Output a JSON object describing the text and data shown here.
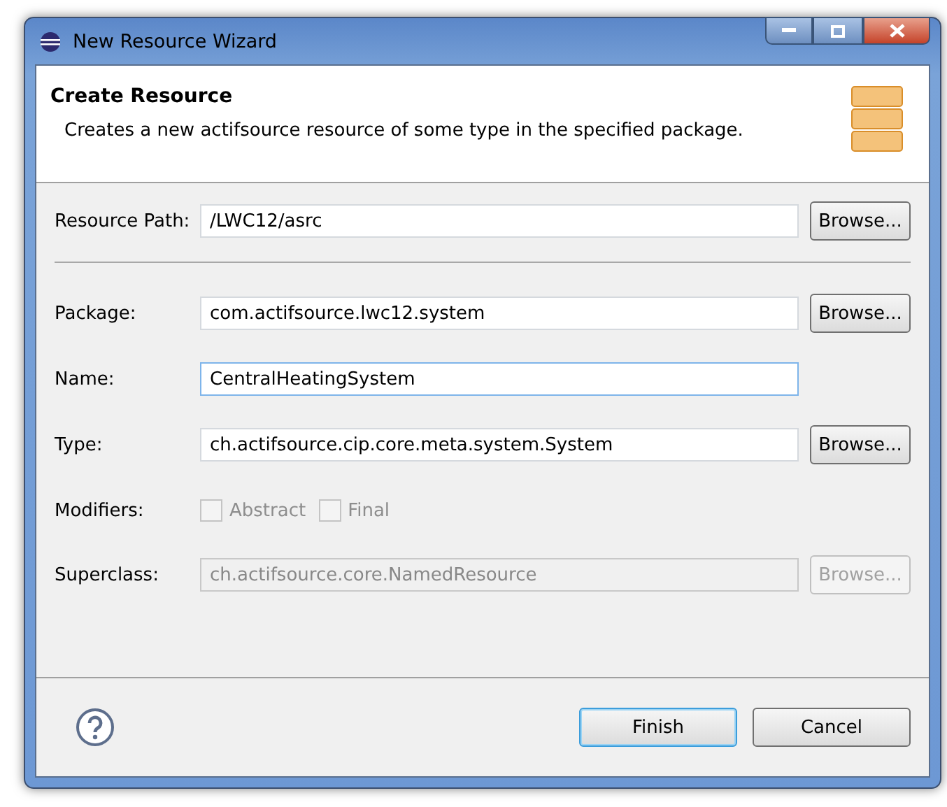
{
  "window": {
    "title": "New Resource Wizard"
  },
  "header": {
    "title": "Create Resource",
    "description": "Creates a new actifsource resource of some type in the specified package."
  },
  "rows": [
    {
      "kind": "field",
      "label": "Resource Path:",
      "value": "/LWC12/asrc",
      "focused": false,
      "disabled": false,
      "browse": {
        "label": "Browse...",
        "disabled": false
      }
    },
    {
      "kind": "separator"
    },
    {
      "kind": "field",
      "label": "Package:",
      "value": "com.actifsource.lwc12.system",
      "focused": false,
      "disabled": false,
      "browse": {
        "label": "Browse...",
        "disabled": false
      }
    },
    {
      "kind": "field",
      "label": "Name:",
      "value": "CentralHeatingSystem",
      "focused": true,
      "disabled": false
    },
    {
      "kind": "field",
      "label": "Type:",
      "value": "ch.actifsource.cip.core.meta.system.System",
      "focused": false,
      "disabled": false,
      "browse": {
        "label": "Browse...",
        "disabled": false
      }
    },
    {
      "kind": "checks",
      "label": "Modifiers:",
      "options": [
        {
          "label": "Abstract",
          "checked": false,
          "disabled": true
        },
        {
          "label": "Final",
          "checked": false,
          "disabled": true
        }
      ]
    },
    {
      "kind": "field",
      "label": "Superclass:",
      "value": "ch.actifsource.core.NamedResource",
      "focused": false,
      "disabled": true,
      "browse": {
        "label": "Browse...",
        "disabled": true
      }
    }
  ],
  "buttons": [
    {
      "label": "Finish",
      "default": true
    },
    {
      "label": "Cancel",
      "default": false
    }
  ]
}
